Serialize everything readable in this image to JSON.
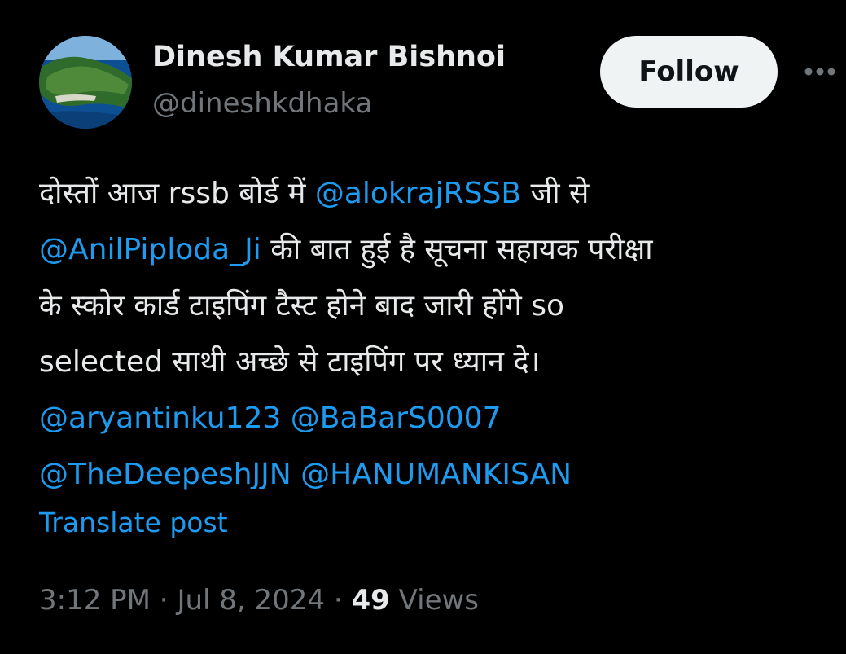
{
  "author": {
    "display_name": "Dinesh Kumar Bishnoi",
    "handle": "@dineshkdhaka",
    "avatar_icon": "island-photo-avatar"
  },
  "actions": {
    "follow_label": "Follow",
    "more_icon": "more-horizontal-icon"
  },
  "tweet": {
    "line1_text1": "दोस्तों आज rssb बोर्ड में ",
    "mention1": "@alokrajRSSB",
    "line1_text2": " जी से",
    "mention2": "@AnilPiploda_Ji",
    "line2_text": " की बात हुई है सूचना सहायक परीक्षा",
    "line3_text": "के स्कोर कार्ड टाइपिंग टैस्ट होने बाद जारी होंगे so",
    "line4_text": "selected साथी अच्छे से टाइपिंग पर ध्यान दे।",
    "mention3": "@aryantinku123",
    "mention4": "@BaBarS0007",
    "mention5": "@TheDeepeshJJN",
    "mention6": "@HANUMANKISAN"
  },
  "translate_label": "Translate post",
  "meta": {
    "time": "3:12 PM",
    "separator": " · ",
    "date": "Jul 8, 2024",
    "views_count": "49",
    "views_label": "Views"
  },
  "colors": {
    "background": "#000000",
    "text": "#e7e9ea",
    "muted": "#71767b",
    "link": "#1d9bf0",
    "follow_bg": "#eff3f4"
  }
}
